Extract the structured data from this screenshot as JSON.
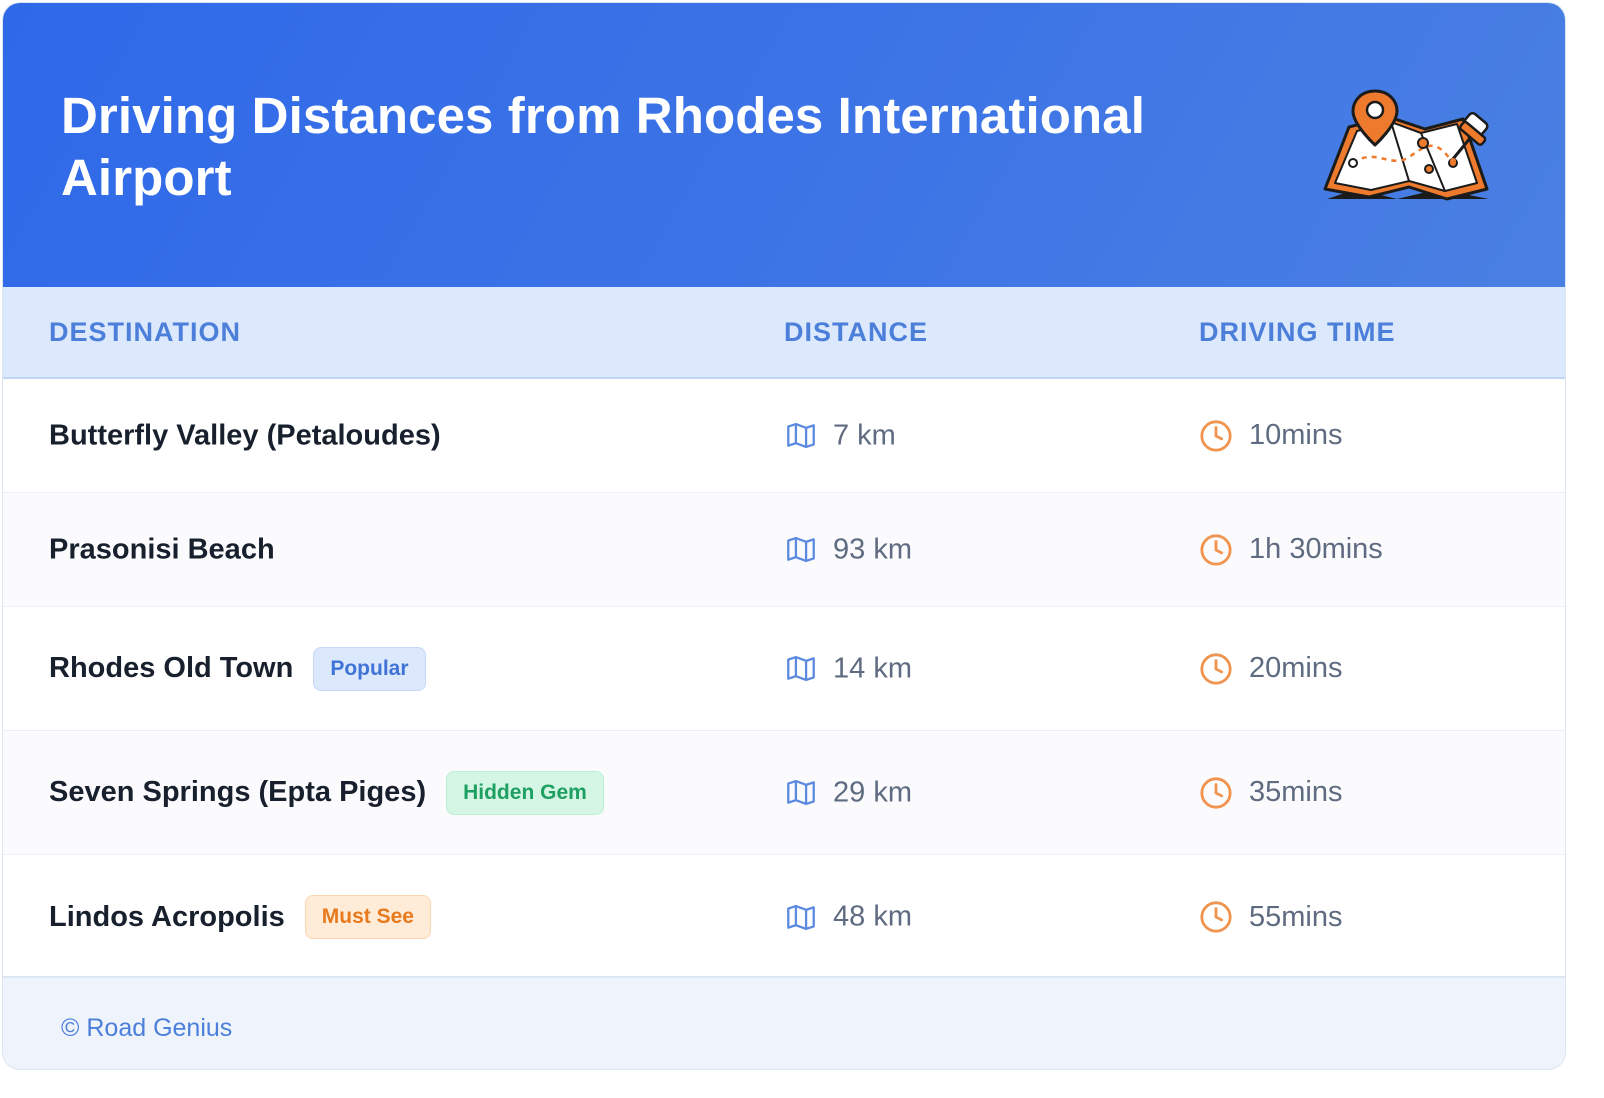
{
  "header": {
    "title": "Driving Distances from Rhodes International Airport",
    "illustration": "map-with-pins-icon"
  },
  "table": {
    "columns": [
      "DESTINATION",
      "DISTANCE",
      "DRIVING TIME"
    ],
    "rows": [
      {
        "destination": "Butterfly Valley (Petaloudes)",
        "badge": null,
        "distance": "7 km",
        "time": "10mins"
      },
      {
        "destination": "Prasonisi Beach",
        "badge": null,
        "distance": "93 km",
        "time": "1h 30mins"
      },
      {
        "destination": "Rhodes Old Town",
        "badge": "Popular",
        "distance": "14 km",
        "time": "20mins"
      },
      {
        "destination": "Seven Springs (Epta Piges)",
        "badge": "Hidden Gem",
        "distance": "29 km",
        "time": "35mins"
      },
      {
        "destination": "Lindos Acropolis",
        "badge": "Must See",
        "distance": "48 km",
        "time": "55mins"
      }
    ]
  },
  "footer": {
    "text": "© Road Genius"
  },
  "icons": {
    "distance": "map-icon",
    "time": "clock-icon"
  },
  "colors": {
    "header_start": "#2f69e8",
    "header_end": "#4a80e2",
    "accent_blue": "#4b7fda",
    "icon_orange": "#f0944f",
    "badge_popular": "#3f74d6",
    "badge_hidden_gem": "#1ea062",
    "badge_must_see": "#e87a1e"
  }
}
